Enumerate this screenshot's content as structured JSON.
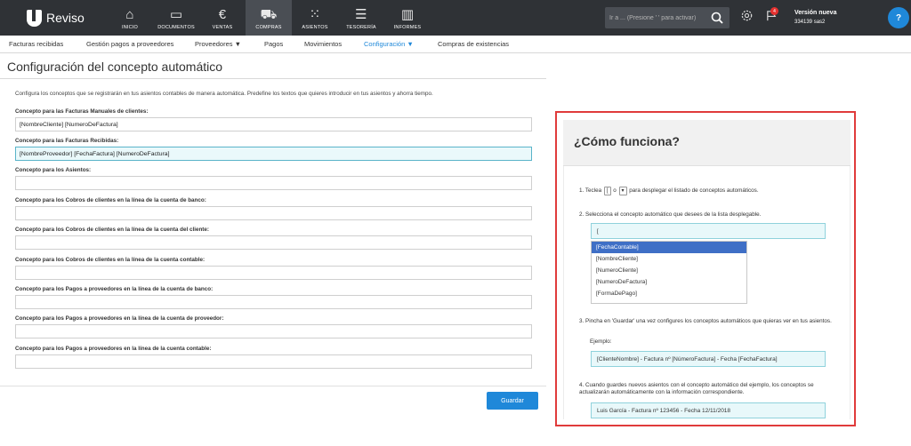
{
  "app": {
    "logo_text": "Reviso"
  },
  "nav": [
    {
      "label": "INICIO",
      "icon": "⌂",
      "icon_name": "home-icon"
    },
    {
      "label": "DOCUMENTOS",
      "icon": "▭",
      "icon_name": "folder-icon"
    },
    {
      "label": "VENTAS",
      "icon": "€",
      "icon_name": "euro-icon"
    },
    {
      "label": "COMPRAS",
      "icon": "⛟",
      "icon_name": "truck-icon"
    },
    {
      "label": "ASIENTOS",
      "icon": "⁙",
      "icon_name": "grid-icon"
    },
    {
      "label": "TESORERÍA",
      "icon": "☰",
      "icon_name": "coins-stack-icon"
    },
    {
      "label": "INFORMES",
      "icon": "▥",
      "icon_name": "bar-chart-icon"
    }
  ],
  "search": {
    "placeholder": "Ir a ... (Presione ' ' para activar)"
  },
  "notifications": {
    "count": "4"
  },
  "version": {
    "title": "Versión nueva",
    "sub": "334139 sas2"
  },
  "help_button": {
    "label": "?"
  },
  "subnav": {
    "facturas_recibidas": "Facturas recibidas",
    "gestion_pagos": "Gestión pagos a proveedores",
    "proveedores": "Proveedores  ▼",
    "pagos": "Pagos",
    "movimientos": "Movimientos",
    "configuracion": "Configuración  ▼",
    "compras_existencias": "Compras de existencias"
  },
  "page": {
    "title": "Configuración del concepto automático",
    "intro": "Configura los conceptos que se registrarán en tus asientos contables de manera automática. Predefine los textos que quieres introducir en tus asientos y ahorra tiempo.",
    "save_label": "Guardar"
  },
  "fields": [
    {
      "label": "Concepto para las Facturas Manuales de clientes:",
      "value": "[NombreCliente] [NumeroDeFactura]"
    },
    {
      "label": "Concepto para las Facturas Recibidas:",
      "value": "[NombreProveedor] [FechaFactura] [NumeroDeFactura]"
    },
    {
      "label": "Concepto para los Asientos:",
      "value": ""
    },
    {
      "label": "Concepto para los Cobros de clientes en la línea de la cuenta de banco:",
      "value": ""
    },
    {
      "label": "Concepto para los Cobros de clientes en la línea de la cuenta del cliente:",
      "value": ""
    },
    {
      "label": "Concepto para los Cobros de clientes en la línea de la cuenta contable:",
      "value": ""
    },
    {
      "label": "Concepto para los Pagos a proveedores en la línea de la cuenta de banco:",
      "value": ""
    },
    {
      "label": "Concepto para los Pagos a proveedores en la línea de la cuenta de proveedor:",
      "value": ""
    },
    {
      "label": "Concepto para los Pagos a proveedores en la línea de la cuenta contable:",
      "value": ""
    }
  ],
  "help_panel": {
    "title": "¿Cómo funciona?",
    "step1_pre": "1. Teclea",
    "step1_key1": "[",
    "step1_or": "o",
    "step1_key2": "▾",
    "step1_post": "para desplegar el listado de conceptos automáticos.",
    "step2": "2. Selecciona el concepto automático que desees de la lista desplegable.",
    "step2_input": "[",
    "dropdown": [
      "[FechaContable]",
      "[NombreCliente]",
      "[NumeroCliente]",
      "[NumeroDeFactura]",
      "[FormaDePago]"
    ],
    "step3": "3. Pincha en 'Guardar' una vez configures los conceptos automáticos que quieras ver en tus asientos.",
    "example_label": "Ejemplo:",
    "example_value": "[ClienteNombre] - Factura nº [NúmeroFactura] - Fecha [FechaFactura]",
    "step4": "4. Cuando guardes nuevos asientos con el concepto automático del ejemplo, los conceptos se actualizarán automáticamente con la información correspondiente.",
    "result_value": "Luis García - Factura nº 123456 - Fecha 12/11/2018"
  }
}
